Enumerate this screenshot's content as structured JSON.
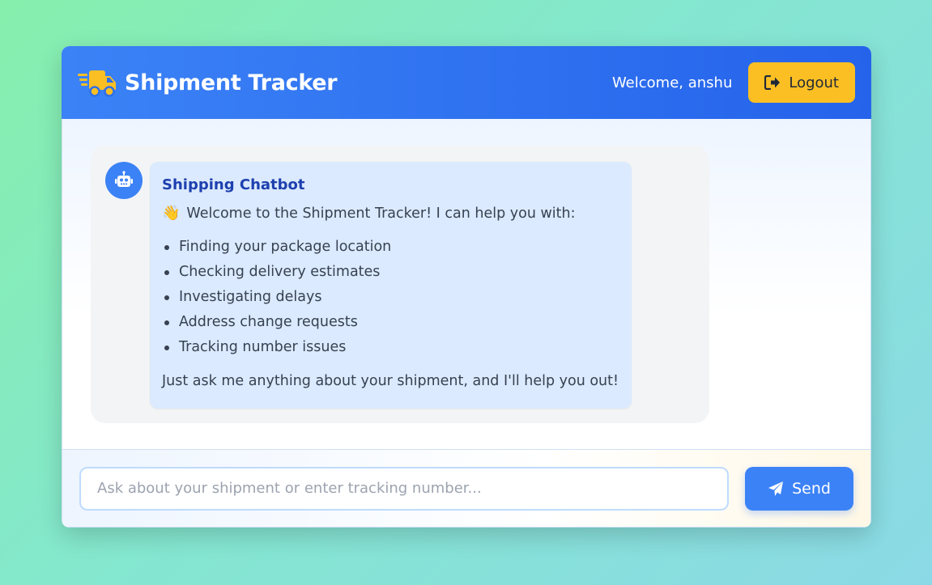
{
  "header": {
    "title": "Shipment Tracker",
    "brand_icon": "truck-icon",
    "welcome_text": "Welcome, anshu",
    "logout_label": "Logout",
    "logout_icon": "logout-icon"
  },
  "chat": {
    "sender": "Shipping Chatbot",
    "avatar_icon": "robot-icon",
    "intro_emoji": "👋",
    "intro": "Welcome to the Shipment Tracker! I can help you with:",
    "features": [
      "Finding your package location",
      "Checking delivery estimates",
      "Investigating delays",
      "Address change requests",
      "Tracking number issues"
    ],
    "outro": "Just ask me anything about your shipment, and I'll help you out!"
  },
  "composer": {
    "placeholder": "Ask about your shipment or enter tracking number...",
    "value": "",
    "send_label": "Send",
    "send_icon": "paper-plane-icon"
  },
  "colors": {
    "header_blue": "#3b82f6",
    "accent_yellow": "#fbbf24",
    "bubble_blue": "#dbeafe"
  }
}
